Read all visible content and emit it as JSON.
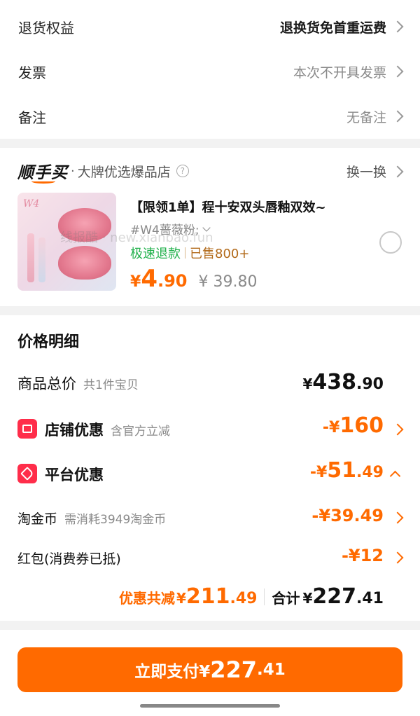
{
  "options": {
    "return_label": "退货权益",
    "return_value": "退换货免首重运费",
    "invoice_label": "发票",
    "invoice_value": "本次不开具发票",
    "note_label": "备注",
    "note_value": "无备注"
  },
  "shunshou": {
    "brand": "顺手买",
    "separator": "·",
    "subtitle": "大牌优选爆品店",
    "swap": "换一换",
    "product_title": "【限领1单】程十安双头唇釉双效~",
    "variant": "#W4蔷薇粉;",
    "tag_refund": "极速退款",
    "tag_sold": "已售800+",
    "price_symbol": "¥",
    "price_int": "4",
    "price_dec": ".90",
    "orig_price": "¥ 39.80",
    "watermark": "线报酷 · new.xianbao.fun"
  },
  "detail": {
    "title": "价格明细",
    "goods_label": "商品总价",
    "goods_count": "共1件宝贝",
    "goods_sym": "¥",
    "goods_int": "438",
    "goods_dec": ".90",
    "shop_label": "店铺优惠",
    "shop_sub": "含官方立减",
    "shop_prefix": "-¥",
    "shop_int": "160",
    "platform_label": "平台优惠",
    "platform_prefix": "-¥",
    "platform_int": "51",
    "platform_dec": ".49",
    "coin_label": "淘金币",
    "coin_sub": "需消耗3949淘金币",
    "coin_value": "-¥39.49",
    "redpack_label": "红包(消费券已抵)",
    "redpack_value": "-¥12",
    "total_discount_label": "优惠共减",
    "total_discount_sym": "¥",
    "total_discount_int": "211",
    "total_discount_dec": ".49",
    "sum_label": "合计",
    "sum_sym": "¥",
    "sum_int": "227",
    "sum_dec": ".41"
  },
  "pay": {
    "label": "立即支付¥",
    "int": "227",
    "dec": ".41"
  },
  "colors": {
    "accent": "#ff6a00",
    "green": "#22b14c",
    "badge_red": "#ff2d4a"
  }
}
